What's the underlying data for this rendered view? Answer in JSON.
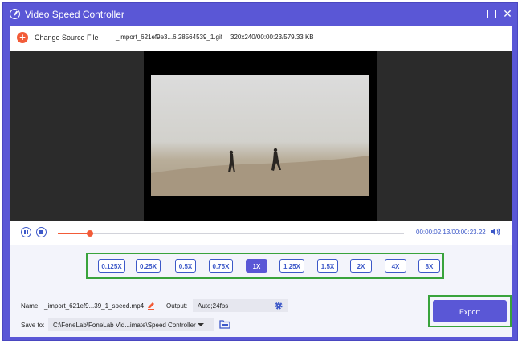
{
  "window": {
    "title": "Video Speed Controller",
    "accent_color": "#5a57d6",
    "highlight_color": "#39a33c",
    "maximize_icon": "maximize-icon",
    "close_icon": "close-icon",
    "close_glyph": "✕"
  },
  "source": {
    "change_label": "Change Source File",
    "filename": "_import_621ef9e3...6.28564539_1.gif",
    "info": "320x240/00:00:23/579.33 KB"
  },
  "player": {
    "current_time": "00:00:02.13",
    "total_time": "00:00:23.22",
    "time_display": "00:00:02.13/00:00:23.22",
    "progress_fraction": 0.092
  },
  "speeds": {
    "options": [
      "0.125X",
      "0.25X",
      "0.5X",
      "0.75X",
      "1X",
      "1.25X",
      "1.5X",
      "2X",
      "4X",
      "8X"
    ],
    "selected": "1X"
  },
  "output": {
    "name_label": "Name:",
    "name_value": "_import_621ef9...39_1_speed.mp4",
    "output_label": "Output:",
    "output_value": "Auto;24fps",
    "save_label": "Save to:",
    "save_path": "C:\\FoneLab\\FoneLab Vid...imate\\Speed Controller",
    "export_label": "Export"
  }
}
